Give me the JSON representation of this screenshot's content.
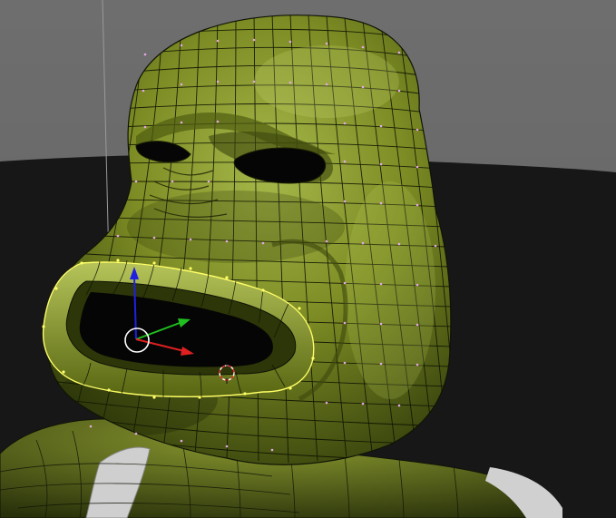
{
  "viewport": {
    "view": "3d-perspective-edit-mode",
    "subject": "green-frog-head-mesh",
    "colors": {
      "background_top": "#6b6b6b",
      "floor": "#161616",
      "mesh_base": "#6b7a1e",
      "mesh_highlight": "#b8c858",
      "mesh_shadow": "#2a3308",
      "wire": "#101406",
      "vertex": "#e6a8e6",
      "selected_edge": "#ffff66",
      "gizmo_x": "#e02020",
      "gizmo_y": "#20c020",
      "gizmo_z": "#2020e0",
      "pivot_ring": "#ffffff",
      "cursor_3d": "#e03030",
      "cloth": "#c8c8c8"
    }
  },
  "gizmo": {
    "axes": [
      "x",
      "y",
      "z"
    ],
    "mode": "translate"
  },
  "cursor_3d": {
    "icon": "3d-cursor-icon"
  }
}
